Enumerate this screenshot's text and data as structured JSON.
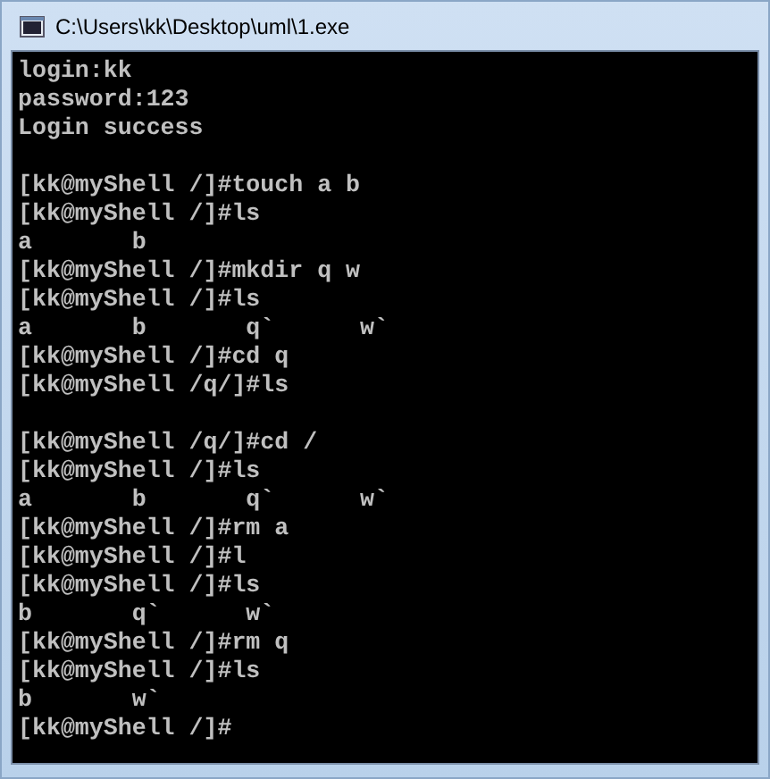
{
  "window": {
    "title": "C:\\Users\\kk\\Desktop\\uml\\1.exe"
  },
  "console": {
    "lines": [
      {
        "kind": "text",
        "text": "login:kk"
      },
      {
        "kind": "text",
        "text": "password:123"
      },
      {
        "kind": "text",
        "text": "Login success"
      },
      {
        "kind": "blank"
      },
      {
        "kind": "text",
        "text": "[kk@myShell /]#touch a b"
      },
      {
        "kind": "text",
        "text": "[kk@myShell /]#ls"
      },
      {
        "kind": "text",
        "text": "a       b"
      },
      {
        "kind": "text",
        "text": "[kk@myShell /]#mkdir q w"
      },
      {
        "kind": "text",
        "text": "[kk@myShell /]#ls"
      },
      {
        "kind": "text",
        "text": "a       b       q`      w`"
      },
      {
        "kind": "text",
        "text": "[kk@myShell /]#cd q"
      },
      {
        "kind": "text",
        "text": "[kk@myShell /q/]#ls"
      },
      {
        "kind": "blank"
      },
      {
        "kind": "text",
        "text": "[kk@myShell /q/]#cd /"
      },
      {
        "kind": "text",
        "text": "[kk@myShell /]#ls"
      },
      {
        "kind": "text",
        "text": "a       b       q`      w`"
      },
      {
        "kind": "text",
        "text": "[kk@myShell /]#rm a"
      },
      {
        "kind": "text",
        "text": "[kk@myShell /]#l"
      },
      {
        "kind": "text",
        "text": "[kk@myShell /]#ls"
      },
      {
        "kind": "text",
        "text": "b       q`      w`"
      },
      {
        "kind": "text",
        "text": "[kk@myShell /]#rm q"
      },
      {
        "kind": "text",
        "text": "[kk@myShell /]#ls"
      },
      {
        "kind": "text",
        "text": "b       w`"
      },
      {
        "kind": "text",
        "text": "[kk@myShell /]#"
      }
    ]
  }
}
